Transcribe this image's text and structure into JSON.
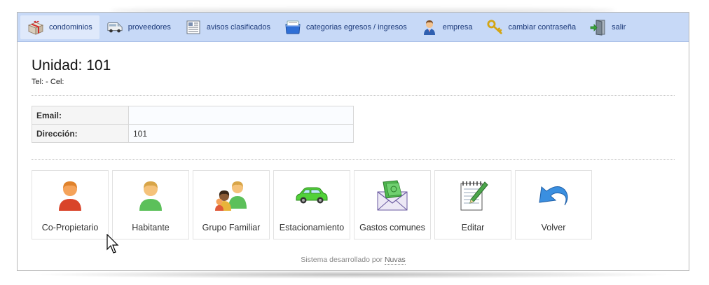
{
  "nav": {
    "items": [
      {
        "label": "condominios",
        "icon": "gift-box-icon",
        "active": true
      },
      {
        "label": "proveedores",
        "icon": "van-icon"
      },
      {
        "label": "avisos clasificados",
        "icon": "newspaper-icon"
      },
      {
        "label": "categorias egresos / ingresos",
        "icon": "folder-box-icon"
      },
      {
        "label": "empresa",
        "icon": "businessman-icon"
      },
      {
        "label": "cambiar contraseña",
        "icon": "keys-icon"
      },
      {
        "label": "salir",
        "icon": "exit-door-icon"
      }
    ]
  },
  "unit": {
    "title": "Unidad: 101",
    "contact": "Tel: - Cel:"
  },
  "info": {
    "rows": [
      {
        "label": "Email:",
        "value": ""
      },
      {
        "label": "Dirección:",
        "value": "101"
      }
    ]
  },
  "actions": [
    {
      "label": "Co-Propietario",
      "icon": "co-owner-person-icon"
    },
    {
      "label": "Habitante",
      "icon": "resident-person-icon"
    },
    {
      "label": "Grupo Familiar",
      "icon": "family-group-icon"
    },
    {
      "label": "Estacionamiento",
      "icon": "car-icon"
    },
    {
      "label": "Gastos comunes",
      "icon": "money-envelope-icon"
    },
    {
      "label": "Editar",
      "icon": "notepad-pencil-icon"
    },
    {
      "label": "Volver",
      "icon": "back-arrow-icon"
    }
  ],
  "footer": {
    "text": "Sistema desarrollado por ",
    "link": "Nuvas"
  }
}
